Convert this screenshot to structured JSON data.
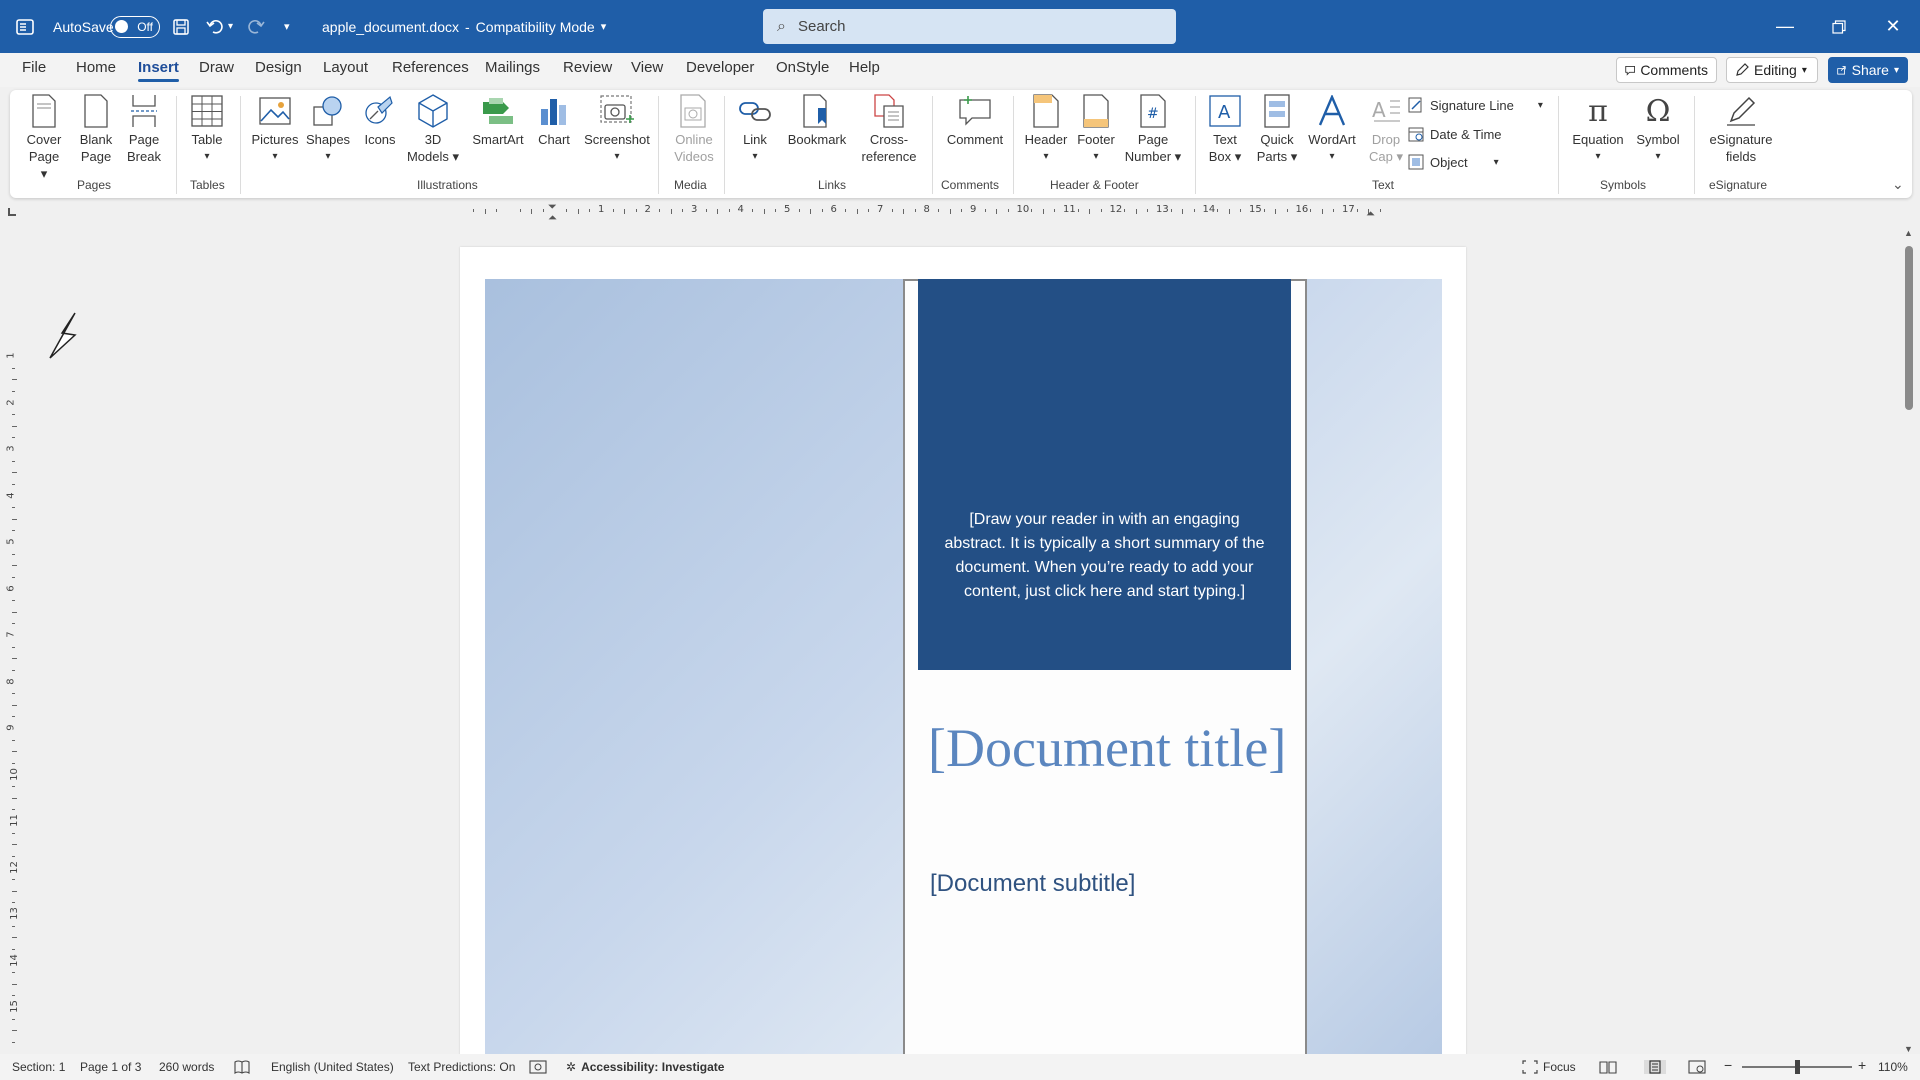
{
  "titlebar": {
    "autosave_label": "AutoSave",
    "autosave_state": "Off",
    "filename": "apple_document.docx",
    "separator": "-",
    "mode": "Compatibility Mode",
    "search_placeholder": "Search"
  },
  "menu": {
    "tabs": [
      "File",
      "Home",
      "Insert",
      "Draw",
      "Design",
      "Layout",
      "References",
      "Mailings",
      "Review",
      "View",
      "Developer",
      "OnStyle",
      "Help"
    ],
    "active_tab": "Insert",
    "comments_label": "Comments",
    "editing_label": "Editing",
    "share_label": "Share"
  },
  "ribbon": {
    "cover_page": [
      "Cover",
      "Page"
    ],
    "blank_page": [
      "Blank",
      "Page"
    ],
    "page_break": [
      "Page",
      "Break"
    ],
    "table": "Table",
    "pictures": "Pictures",
    "shapes": "Shapes",
    "icons": "Icons",
    "models": [
      "3D",
      "Models"
    ],
    "smartart": "SmartArt",
    "chart": "Chart",
    "screenshot": "Screenshot",
    "online_videos": [
      "Online",
      "Videos"
    ],
    "link": "Link",
    "bookmark": "Bookmark",
    "cross_reference": [
      "Cross-",
      "reference"
    ],
    "comment": "Comment",
    "header": "Header",
    "footer": "Footer",
    "page_number": [
      "Page",
      "Number"
    ],
    "text_box": [
      "Text",
      "Box"
    ],
    "quick_parts": [
      "Quick",
      "Parts"
    ],
    "wordart": "WordArt",
    "drop_cap": [
      "Drop",
      "Cap"
    ],
    "signature_line": "Signature Line",
    "date_time": "Date & Time",
    "object": "Object",
    "equation": "Equation",
    "symbol": "Symbol",
    "esignature": [
      "eSignature",
      "fields"
    ],
    "groups": {
      "pages": "Pages",
      "tables": "Tables",
      "illustrations": "Illustrations",
      "media": "Media",
      "links": "Links",
      "comments": "Comments",
      "header_footer": "Header & Footer",
      "text": "Text",
      "symbols": "Symbols",
      "esignature": "eSignature"
    }
  },
  "ruler": {
    "h_numbers": [
      "1",
      "2",
      "3",
      "4",
      "5",
      "6",
      "7",
      "8",
      "9",
      "10",
      "11",
      "12",
      "13",
      "14",
      "15",
      "16",
      "17"
    ],
    "v_numbers": [
      "1",
      "2",
      "3",
      "4",
      "5",
      "6",
      "7",
      "8",
      "9",
      "10",
      "11",
      "12",
      "13",
      "14",
      "15"
    ]
  },
  "document": {
    "abstract": "[Draw your reader in with an engaging abstract. It is typically a short summary of the document. When you’re ready to add your content, just click here and start typing.]",
    "title": "[Document title]",
    "subtitle": "[Document subtitle]"
  },
  "status": {
    "section": "Section: 1",
    "page": "Page 1 of 3",
    "words": "260 words",
    "language": "English (United States)",
    "text_predictions": "Text Predictions: On",
    "accessibility": "Accessibility: Investigate",
    "focus": "Focus",
    "zoom": "110%",
    "zoom_minus": "−",
    "zoom_plus": "+"
  },
  "colors": {
    "titlebar": "#1f5ea8",
    "abstract_bg": "#234f85",
    "title_text": "#5b86bf"
  }
}
